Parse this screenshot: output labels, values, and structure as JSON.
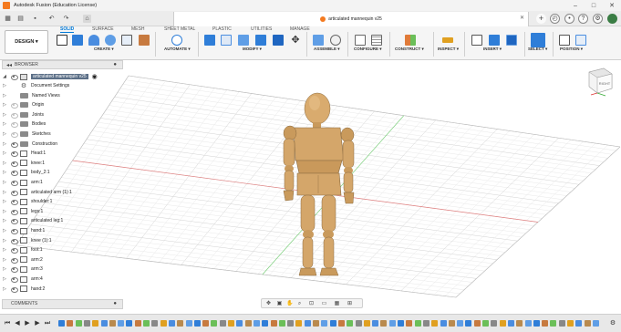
{
  "window": {
    "title": "Autodesk Fusion (Education License)"
  },
  "document_tab": {
    "title": "articulated mannequin v25"
  },
  "ribbon": {
    "workspace": "DESIGN",
    "tabs": [
      "SOLID",
      "SURFACE",
      "MESH",
      "SHEET METAL",
      "PLASTIC",
      "UTILITIES",
      "MANAGE"
    ],
    "active_tab": "SOLID",
    "groups": [
      "CREATE",
      "AUTOMATE",
      "MODIFY",
      "ASSEMBLE",
      "CONFIGURE",
      "CONSTRUCT",
      "INSPECT",
      "INSERT",
      "SELECT",
      "POSITION"
    ]
  },
  "browser": {
    "header": "BROWSER",
    "root": "articulated mannequin v25",
    "items": [
      {
        "label": "Document Settings",
        "kind": "gear",
        "eye": "none"
      },
      {
        "label": "Named Views",
        "kind": "folder",
        "eye": "none"
      },
      {
        "label": "Origin",
        "kind": "folder",
        "eye": "dim"
      },
      {
        "label": "Joints",
        "kind": "folder",
        "eye": "dim"
      },
      {
        "label": "Bodies",
        "kind": "folder",
        "eye": "dim"
      },
      {
        "label": "Sketches",
        "kind": "folder",
        "eye": "dim"
      },
      {
        "label": "Construction",
        "kind": "folder",
        "eye": "on"
      },
      {
        "label": "Head:1",
        "kind": "comp",
        "eye": "on"
      },
      {
        "label": "knee:1",
        "kind": "comp",
        "eye": "on"
      },
      {
        "label": "body_2:1",
        "kind": "comp",
        "eye": "on"
      },
      {
        "label": "arm:1",
        "kind": "comp",
        "eye": "on"
      },
      {
        "label": "articulated arm (1):1",
        "kind": "comp",
        "eye": "on"
      },
      {
        "label": "shoulder:1",
        "kind": "comp",
        "eye": "on"
      },
      {
        "label": "legs:1",
        "kind": "comp",
        "eye": "on"
      },
      {
        "label": "articulated leg:1",
        "kind": "comp",
        "eye": "on"
      },
      {
        "label": "hand:1",
        "kind": "comp",
        "eye": "on"
      },
      {
        "label": "knee (1):1",
        "kind": "comp",
        "eye": "on"
      },
      {
        "label": "foot:1",
        "kind": "comp",
        "eye": "on"
      },
      {
        "label": "arm:2",
        "kind": "comp",
        "eye": "on"
      },
      {
        "label": "arm:3",
        "kind": "comp",
        "eye": "on"
      },
      {
        "label": "arm:4",
        "kind": "comp",
        "eye": "on"
      },
      {
        "label": "hand:2",
        "kind": "comp",
        "eye": "on"
      }
    ]
  },
  "comments": {
    "label": "COMMENTS"
  },
  "viewcube": {
    "face": "RIGHT"
  },
  "colors": {
    "accent": "#0078d7",
    "brand": "#f47a20",
    "wood": "#d4a66a",
    "wood_dark": "#b98a4e"
  }
}
